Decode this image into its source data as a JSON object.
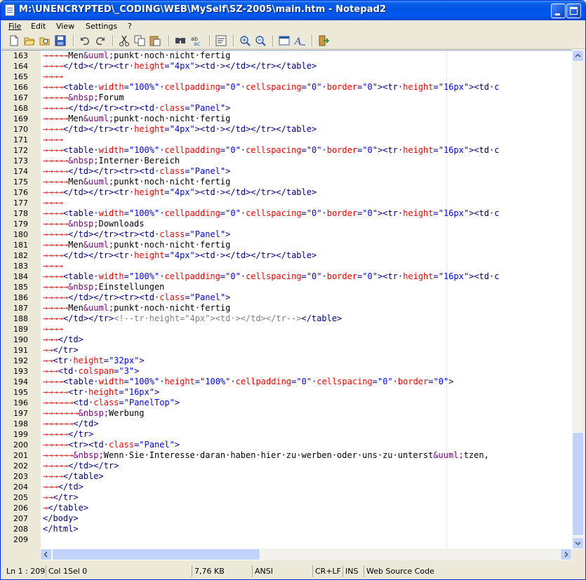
{
  "window": {
    "title": "M:\\UNENCRYPTED\\_CODING\\WEB\\MySelf\\SZ-2005\\main.htm - Notepad2"
  },
  "menu": [
    "File",
    "Edit",
    "View",
    "Settings",
    "?"
  ],
  "toolbar_icons": [
    "new-file-icon",
    "open-icon",
    "browse-icon",
    "save-icon",
    "undo-icon",
    "redo-icon",
    "cut-icon",
    "copy-icon",
    "paste-icon",
    "find-icon",
    "replace-icon",
    "word-wrap-icon",
    "zoom-in-icon",
    "zoom-out-icon",
    "schemes-icon",
    "font-icon",
    "exit-icon"
  ],
  "editor": {
    "lines": [
      {
        "n": "163",
        "t": "→→→→→Men&uuml;punkt·noch·nicht·fertig"
      },
      {
        "n": "164",
        "t": "→→→→</td></tr><tr·height=\"4px\"><td·></td></tr></table>"
      },
      {
        "n": "165",
        "t": "→→→→"
      },
      {
        "n": "166",
        "t": "→→→→<table·width=\"100%\"·cellpadding=\"0\"·cellspacing=\"0\"·border=\"0\"><tr·height=\"16px\"><td·c"
      },
      {
        "n": "167",
        "t": "→→→→→&nbsp;Forum"
      },
      {
        "n": "168",
        "t": "→→→→→</td></tr><tr><td·class=\"Panel\">"
      },
      {
        "n": "169",
        "t": "→→→→→Men&uuml;punkt·noch·nicht·fertig"
      },
      {
        "n": "170",
        "t": "→→→→</td></tr><tr·height=\"4px\"><td·></td></tr></table>"
      },
      {
        "n": "171",
        "t": "→→→→"
      },
      {
        "n": "172",
        "t": "→→→→<table·width=\"100%\"·cellpadding=\"0\"·cellspacing=\"0\"·border=\"0\"><tr·height=\"16px\"><td·c"
      },
      {
        "n": "173",
        "t": "→→→→→&nbsp;Interner·Bereich"
      },
      {
        "n": "174",
        "t": "→→→→→</td></tr><tr><td·class=\"Panel\">"
      },
      {
        "n": "175",
        "t": "→→→→→Men&uuml;punkt·noch·nicht·fertig"
      },
      {
        "n": "176",
        "t": "→→→→</td></tr><tr·height=\"4px\"><td·></td></tr></table>"
      },
      {
        "n": "177",
        "t": "→→→→"
      },
      {
        "n": "178",
        "t": "→→→→<table·width=\"100%\"·cellpadding=\"0\"·cellspacing=\"0\"·border=\"0\"><tr·height=\"16px\"><td·c"
      },
      {
        "n": "179",
        "t": "→→→→→&nbsp;Downloads"
      },
      {
        "n": "180",
        "t": "→→→→→</td></tr><tr><td·class=\"Panel\">"
      },
      {
        "n": "181",
        "t": "→→→→→Men&uuml;punkt·noch·nicht·fertig"
      },
      {
        "n": "182",
        "t": "→→→→</td></tr><tr·height=\"4px\"><td·></td></tr></table>"
      },
      {
        "n": "183",
        "t": "→→→→"
      },
      {
        "n": "184",
        "t": "→→→→<table·width=\"100%\"·cellpadding=\"0\"·cellspacing=\"0\"·border=\"0\"><tr·height=\"16px\"><td·c"
      },
      {
        "n": "185",
        "t": "→→→→→&nbsp;Einstellungen"
      },
      {
        "n": "186",
        "t": "→→→→→</td></tr><tr><td·class=\"Panel\">"
      },
      {
        "n": "187",
        "t": "→→→→→Men&uuml;punkt·noch·nicht·fertig"
      },
      {
        "n": "188",
        "t": "→→→→</td></tr><!--tr·height=\"4px\"><td·></td></tr--></table>"
      },
      {
        "n": "189",
        "t": "→→→→"
      },
      {
        "n": "190",
        "t": "→→→</td>"
      },
      {
        "n": "191",
        "t": "→→</tr>"
      },
      {
        "n": "192",
        "t": "→→<tr·height=\"32px\">"
      },
      {
        "n": "193",
        "t": "→→→<td·colspan=\"3\">"
      },
      {
        "n": "194",
        "t": "→→→→<table·width=\"100%\"·height=\"100%\"·cellpadding=\"0\"·cellspacing=\"0\"·border=\"0\">"
      },
      {
        "n": "195",
        "t": "→→→→→<tr·height=\"16px\">"
      },
      {
        "n": "196",
        "t": "→→→→→→<td·class=\"PanelTop\">"
      },
      {
        "n": "197",
        "t": "→→→→→→→&nbsp;Werbung"
      },
      {
        "n": "198",
        "t": "→→→→→→</td>"
      },
      {
        "n": "199",
        "t": "→→→→→</tr>"
      },
      {
        "n": "200",
        "t": "→→→→→<tr><td·class=\"Panel\">"
      },
      {
        "n": "201",
        "t": "→→→→→→&nbsp;Wenn·Sie·Interesse·daran·haben·hier·zu·werben·oder·uns·zu·unterst&uuml;tzen,"
      },
      {
        "n": "202",
        "t": "→→→→→</td></tr>"
      },
      {
        "n": "203",
        "t": "→→→→</table>"
      },
      {
        "n": "204",
        "t": "→→→</td>"
      },
      {
        "n": "205",
        "t": "→→</tr>"
      },
      {
        "n": "206",
        "t": "→</table>"
      },
      {
        "n": "207",
        "t": "</body>"
      },
      {
        "n": "208",
        "t": "</html>"
      },
      {
        "n": "209",
        "t": ""
      }
    ]
  },
  "status": {
    "position": "Ln 1 : 209",
    "col": "Col 1",
    "sel": "Sel 0",
    "size": "7,76 KB",
    "encoding": "ANSI",
    "eol": "CR+LF",
    "mode": "INS",
    "scheme": "Web Source Code"
  }
}
